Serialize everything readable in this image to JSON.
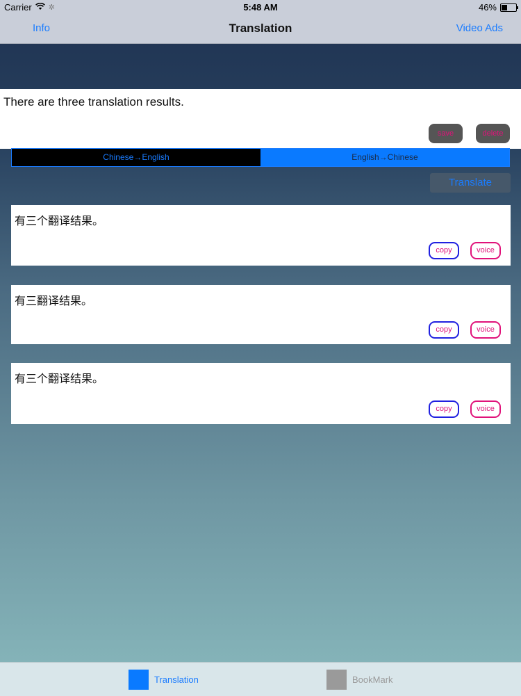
{
  "status_bar": {
    "carrier": "Carrier",
    "time": "5:48 AM",
    "battery": "46%",
    "battery_level": 0.46
  },
  "nav": {
    "left": "Info",
    "title": "Translation",
    "right": "Video Ads"
  },
  "input": {
    "text": "There are three translation results.",
    "save_label": "save",
    "delete_label": "delete"
  },
  "direction": {
    "option_a": "Chinese→English",
    "option_b": "English→Chinese",
    "selected": "English→Chinese"
  },
  "translate_label": "Translate",
  "results": [
    {
      "text": "有三个翻译结果。",
      "copy": "copy",
      "voice": "voice"
    },
    {
      "text": "有三翻译结果。",
      "copy": "copy",
      "voice": "voice"
    },
    {
      "text": "有三个翻译结果。",
      "copy": "copy",
      "voice": "voice"
    }
  ],
  "tabs": [
    {
      "label": "Translation",
      "icon": "translation-tab-icon",
      "selected": true
    },
    {
      "label": "BookMark",
      "icon": "bookmark-tab-icon",
      "selected": false
    }
  ],
  "colors": {
    "accent": "#0a7aff",
    "pink": "#e0127a",
    "copy_border": "#2020e0"
  }
}
